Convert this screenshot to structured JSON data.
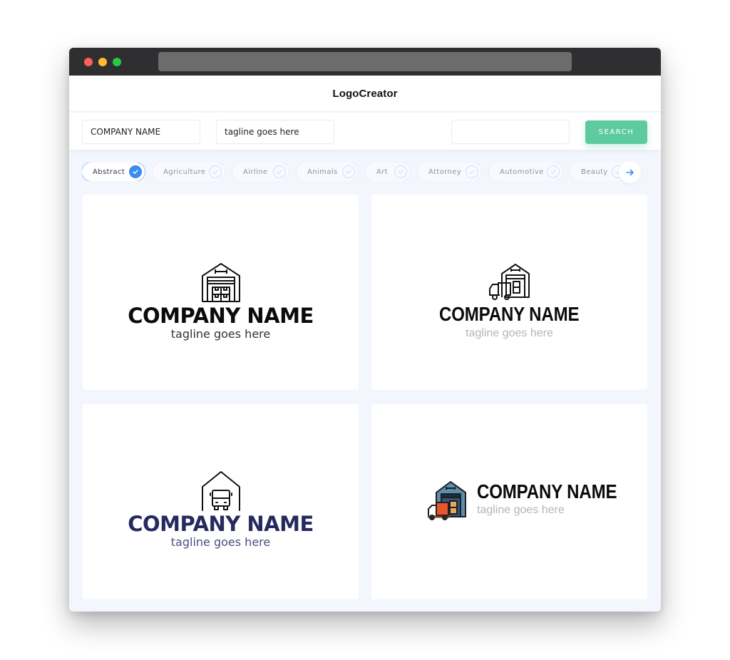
{
  "app": {
    "title": "LogoCreator"
  },
  "search": {
    "company_name_value": "COMPANY NAME",
    "tagline_value": "tagline goes here",
    "query_value": "",
    "search_label": "SEARCH"
  },
  "categories": [
    {
      "label": "Abstract",
      "selected": true
    },
    {
      "label": "Agriculture",
      "selected": false
    },
    {
      "label": "Airline",
      "selected": false
    },
    {
      "label": "Animals",
      "selected": false
    },
    {
      "label": "Art",
      "selected": false
    },
    {
      "label": "Attorney",
      "selected": false
    },
    {
      "label": "Automotive",
      "selected": false
    },
    {
      "label": "Beauty",
      "selected": false
    }
  ],
  "next_icon": "arrow-right-icon",
  "logos": [
    {
      "icon": "warehouse-boxes-icon",
      "company": "COMPANY NAME",
      "tagline": "tagline goes here",
      "name_color": "#0b0b0b",
      "tagline_color": "#333333"
    },
    {
      "icon": "warehouse-truck-icon",
      "company": "COMPANY NAME",
      "tagline": "tagline goes here",
      "name_color": "#0b0b0b",
      "tagline_color": "#b5b5b5"
    },
    {
      "icon": "garage-truck-icon",
      "company": "COMPANY NAME",
      "tagline": "tagline goes here",
      "name_color": "#262a5e",
      "tagline_color": "#4a4e80"
    },
    {
      "icon": "warehouse-truck-color-icon",
      "company": "COMPANY NAME",
      "tagline": "tagline goes here",
      "name_color": "#0b0b0b",
      "tagline_color": "#b5b5b5"
    }
  ],
  "colors": {
    "accent": "#3b8cf0",
    "search_button": "#5ecb9f",
    "background": "#f3f6fd"
  }
}
